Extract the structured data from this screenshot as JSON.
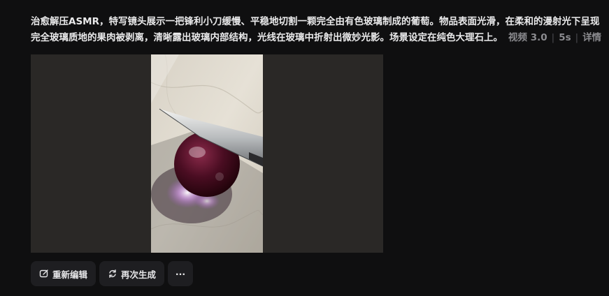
{
  "prompt": {
    "line1": "治愈解压ASMR，特写镜头展示一把锋利小刀缓慢、平稳地切割一颗完全由有色玻璃制成的葡萄。物品表面光滑，在柔和的漫射光下呈现",
    "line2": "完全玻璃质地的果肉被剥离，清晰露出玻璃内部结构，光线在玻璃中折射出微妙光影。场景设定在纯色大理石上。"
  },
  "meta": {
    "model": "视频 3.0",
    "duration": "5s",
    "details": "详情"
  },
  "actions": {
    "reedit": "重新编辑",
    "regenerate": "再次生成",
    "more": "···"
  }
}
